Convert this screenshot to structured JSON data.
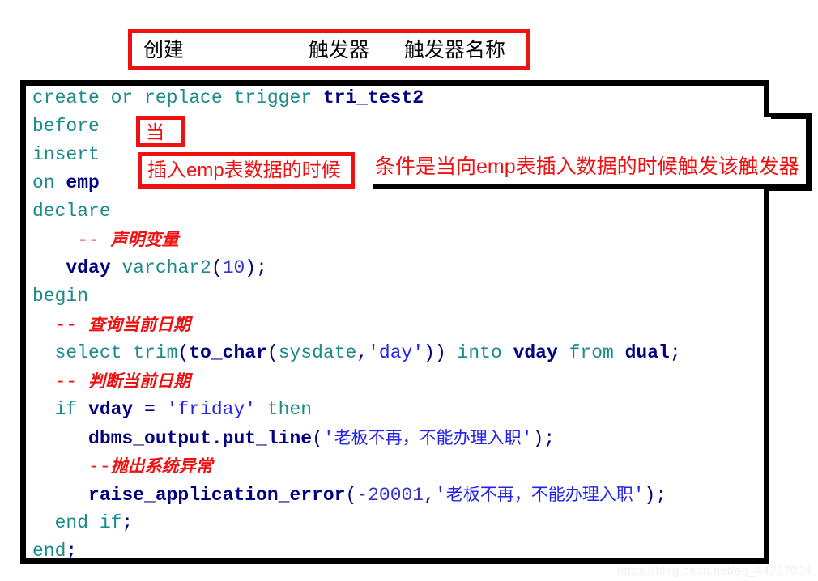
{
  "header_annotation": {
    "labels": [
      "创建",
      "触发器",
      "触发器名称"
    ],
    "border_color": "#ee1111",
    "text_color": "#000000"
  },
  "code": {
    "language": "PL/SQL",
    "lines": [
      [
        {
          "t": "create or replace trigger ",
          "c": "kw"
        },
        {
          "t": "tri_test2",
          "c": "id"
        }
      ],
      [
        {
          "t": "before",
          "c": "kw"
        }
      ],
      [
        {
          "t": "insert",
          "c": "kw"
        }
      ],
      [
        {
          "t": "on ",
          "c": "kw"
        },
        {
          "t": "emp",
          "c": "id"
        }
      ],
      [
        {
          "t": "declare",
          "c": "kw"
        }
      ],
      [
        {
          "t": "    ",
          "c": "plain"
        },
        {
          "t": "-- ",
          "c": "cmt-dash"
        },
        {
          "t": "声明变量",
          "c": "cmt"
        }
      ],
      [
        {
          "t": "   ",
          "c": "plain"
        },
        {
          "t": "vday",
          "c": "id"
        },
        {
          "t": " varchar2",
          "c": "kw"
        },
        {
          "t": "(",
          "c": "punct"
        },
        {
          "t": "10",
          "c": "num"
        },
        {
          "t": ")",
          "c": "punct"
        },
        {
          "t": ";",
          "c": "punct"
        }
      ],
      [
        {
          "t": "begin",
          "c": "kw"
        }
      ],
      [
        {
          "t": "  ",
          "c": "plain"
        },
        {
          "t": "-- ",
          "c": "cmt-dash"
        },
        {
          "t": "查询当前日期",
          "c": "cmt"
        }
      ],
      [
        {
          "t": "  select trim",
          "c": "kw"
        },
        {
          "t": "(",
          "c": "punct"
        },
        {
          "t": "to_char",
          "c": "id"
        },
        {
          "t": "(",
          "c": "punct"
        },
        {
          "t": "sysdate",
          "c": "kw"
        },
        {
          "t": ",",
          "c": "punct"
        },
        {
          "t": "'day'",
          "c": "str"
        },
        {
          "t": "))",
          "c": "punct"
        },
        {
          "t": " into ",
          "c": "kw"
        },
        {
          "t": "vday",
          "c": "id"
        },
        {
          "t": " from ",
          "c": "kw"
        },
        {
          "t": "dual",
          "c": "id"
        },
        {
          "t": ";",
          "c": "punct"
        }
      ],
      [
        {
          "t": "  ",
          "c": "plain"
        },
        {
          "t": "-- ",
          "c": "cmt-dash"
        },
        {
          "t": "判断当前日期",
          "c": "cmt"
        }
      ],
      [
        {
          "t": "  if ",
          "c": "kw"
        },
        {
          "t": "vday",
          "c": "id"
        },
        {
          "t": " = ",
          "c": "punct"
        },
        {
          "t": "'friday'",
          "c": "str"
        },
        {
          "t": " then",
          "c": "kw"
        }
      ],
      [
        {
          "t": "     ",
          "c": "plain"
        },
        {
          "t": "dbms_output.put_line",
          "c": "id"
        },
        {
          "t": "(",
          "c": "punct"
        },
        {
          "t": "'",
          "c": "str"
        },
        {
          "t": "老板不再，不能办理入职",
          "c": "cjk"
        },
        {
          "t": "'",
          "c": "str"
        },
        {
          "t": ")",
          "c": "punct"
        },
        {
          "t": ";",
          "c": "punct"
        }
      ],
      [
        {
          "t": "     ",
          "c": "plain"
        },
        {
          "t": "--",
          "c": "cmt-dash"
        },
        {
          "t": "抛出系统异常",
          "c": "cmt"
        }
      ],
      [
        {
          "t": "     ",
          "c": "plain"
        },
        {
          "t": "raise_application_error",
          "c": "id"
        },
        {
          "t": "(",
          "c": "punct"
        },
        {
          "t": "-20001",
          "c": "num"
        },
        {
          "t": ",",
          "c": "punct"
        },
        {
          "t": "'",
          "c": "str"
        },
        {
          "t": "老板不再，不能办理入职",
          "c": "cjk"
        },
        {
          "t": "'",
          "c": "str"
        },
        {
          "t": ")",
          "c": "punct"
        },
        {
          "t": ";",
          "c": "punct"
        }
      ],
      [
        {
          "t": "  end if",
          "c": "kw"
        },
        {
          "t": ";",
          "c": "punct"
        }
      ],
      [
        {
          "t": "end",
          "c": "kw"
        },
        {
          "t": ";",
          "c": "punct"
        }
      ]
    ],
    "colors": {
      "keyword": "#1a8a8a",
      "identifier": "#000080",
      "string": "#2222ee",
      "number": "#3333cc",
      "comment": "#ee1111"
    }
  },
  "callouts": {
    "dang": "当",
    "insert_when": "插入emp表数据的时候",
    "side_note": "条件是当向emp表插入数据的时候触发该触发器"
  },
  "watermark": {
    "text": "https://blog.csdn.net/qq_44757034"
  }
}
